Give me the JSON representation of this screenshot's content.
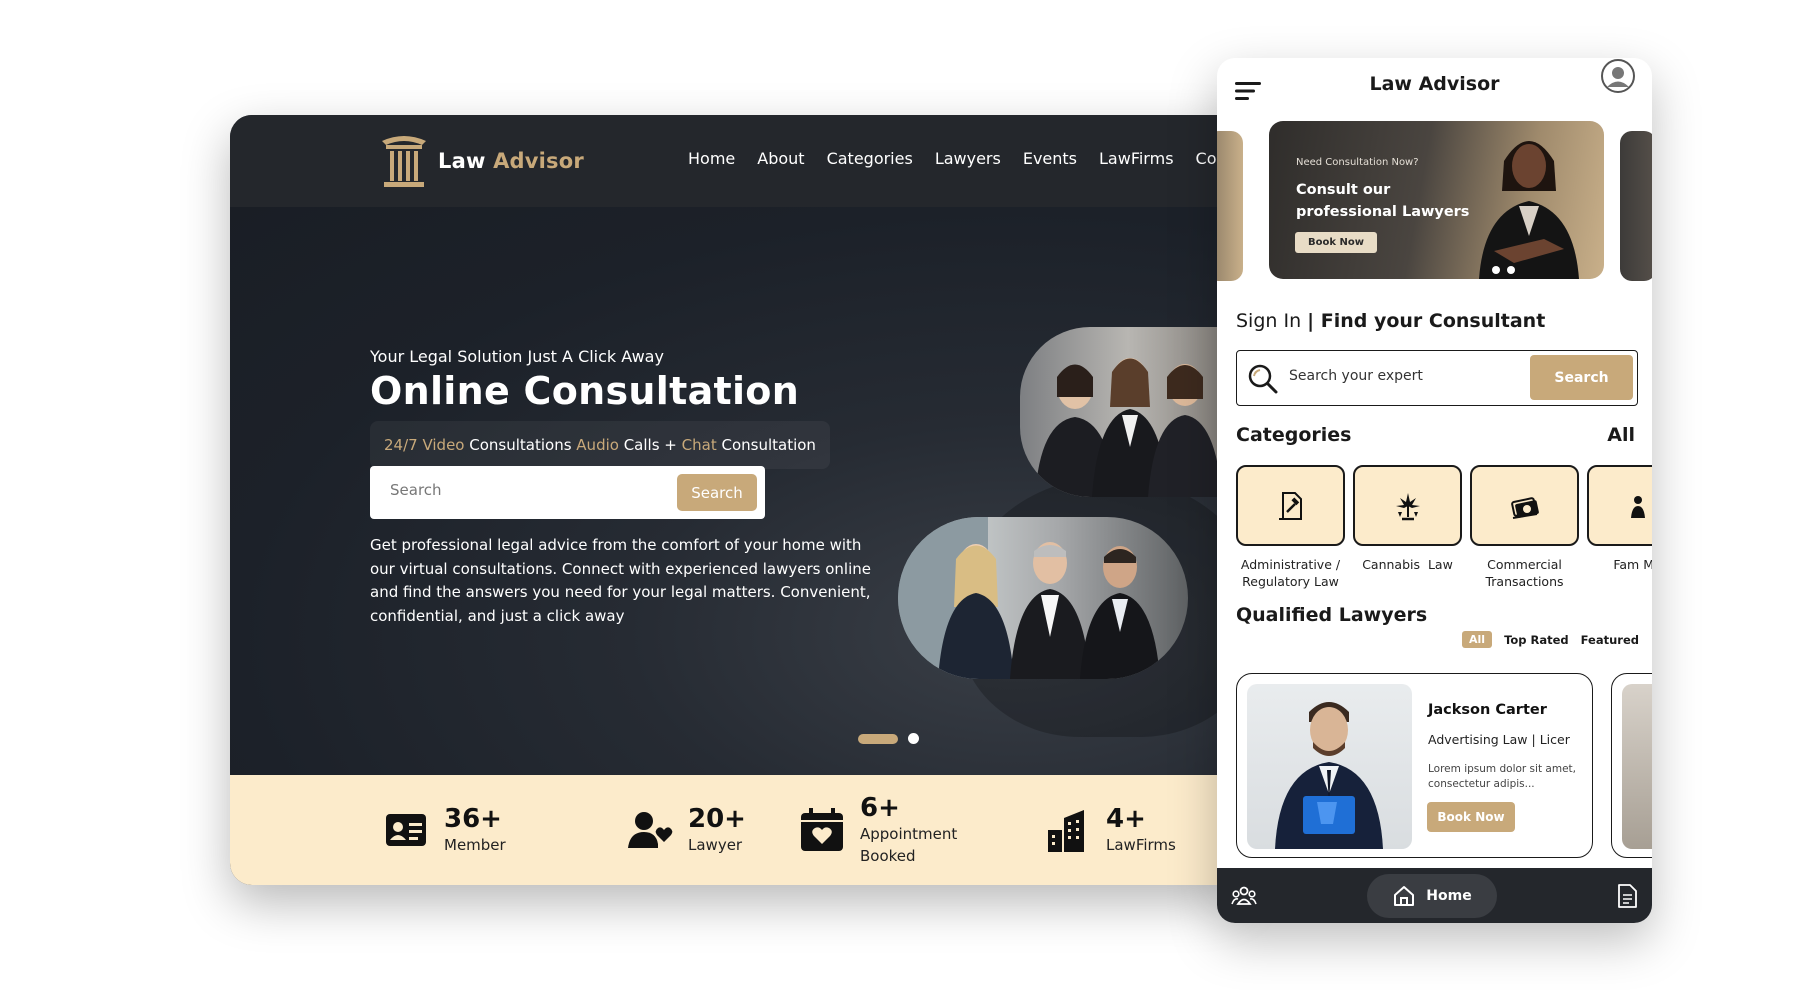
{
  "desktop": {
    "brand": {
      "word1": "Law",
      "word2": "Advisor"
    },
    "nav": [
      "Home",
      "About",
      "Categories",
      "Lawyers",
      "Events",
      "LawFirms",
      "Comm"
    ],
    "hero": {
      "tagline": "Your Legal Solution Just A Click Away",
      "headline": "Online Consultation",
      "pill": {
        "p1": "24/7 Video",
        "p2": " Consultations ",
        "p3": "Audio",
        "p4": " Calls + ",
        "p5": "Chat",
        "p6": " Consultation"
      },
      "search_placeholder": "Search",
      "search_button": "Search",
      "paragraph": "Get professional legal advice from the comfort of your home with our virtual consultations. Connect with experienced lawyers online and find the answers you need for your legal matters. Convenient, confidential, and just a click away"
    },
    "stats": [
      {
        "num": "36+",
        "label": "Member"
      },
      {
        "num": "20+",
        "label": "Lawyer"
      },
      {
        "num": "6+",
        "label": "Appointment",
        "label2": "Booked"
      },
      {
        "num": "4+",
        "label": "LawFirms"
      }
    ]
  },
  "mobile": {
    "title": "Law Advisor",
    "banner": {
      "small": "Need Consultation Now?",
      "big": "Consult our professional Lawyers",
      "button": "Book Now"
    },
    "signin": {
      "prefix": "Sign In ",
      "bold": "| Find your Consultant"
    },
    "search": {
      "placeholder": "Search your expert",
      "button": "Search"
    },
    "categories": {
      "title": "Categories",
      "all": "All",
      "items": [
        {
          "label": "Administrative / Regulatory Law"
        },
        {
          "label": "Cannabis  Law"
        },
        {
          "label": "Commercial Transactions"
        },
        {
          "label": "Fam Med"
        }
      ]
    },
    "lawyers": {
      "title": "Qualified Lawyers",
      "filters": [
        "All",
        "Top Rated",
        "Featured"
      ],
      "card": {
        "name": "Jackson Carter",
        "spec": "Advertising Law | Licer",
        "desc": "Lorem ipsum dolor sit amet, consectetur adipis...",
        "button": "Book Now"
      }
    },
    "tabbar": {
      "home": "Home"
    }
  },
  "colors": {
    "gold": "#c8a97a",
    "dark": "#24272c",
    "cream": "#fcebcb"
  }
}
